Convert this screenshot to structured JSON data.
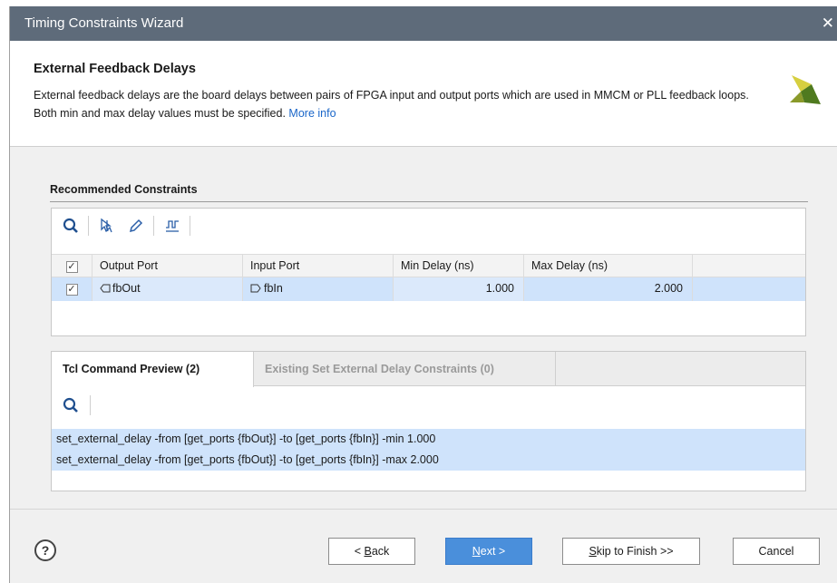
{
  "window": {
    "title": "Timing Constraints Wizard",
    "close_glyph": "✕"
  },
  "header": {
    "title": "External Feedback Delays",
    "description": "External feedback delays are the board delays between pairs of FPGA input and output ports which are used in MMCM or PLL feedback loops. Both min and max delay values must be specified.",
    "more_info": "More info"
  },
  "recommended": {
    "label": "Recommended Constraints",
    "toolbar": [
      "search-icon",
      "select-pointer-icon",
      "edit-pencil-icon",
      "waveform-icon"
    ],
    "columns": [
      "Output Port",
      "Input Port",
      "Min Delay (ns)",
      "Max Delay (ns)"
    ],
    "header_checked": true,
    "rows": [
      {
        "checked": true,
        "output_port": "fbOut",
        "input_port": "fbIn",
        "min_delay": "1.000",
        "max_delay": "2.000"
      }
    ]
  },
  "tcl": {
    "tabs": [
      {
        "label": "Tcl Command Preview (2)",
        "active": true
      },
      {
        "label": "Existing Set External Delay Constraints (0)",
        "active": false
      }
    ],
    "lines": [
      "set_external_delay -from [get_ports {fbOut}] -to [get_ports {fbIn}] -min 1.000",
      "set_external_delay -from [get_ports {fbOut}] -to [get_ports {fbIn}] -max 2.000"
    ]
  },
  "footer": {
    "help": "?",
    "back": {
      "prefix": "< ",
      "mnemonic": "B",
      "rest": "ack"
    },
    "next": {
      "mnemonic": "N",
      "rest": "ext >"
    },
    "skip": {
      "mnemonic": "S",
      "rest": "kip to Finish >>"
    },
    "cancel": "Cancel"
  },
  "colors": {
    "titlebar": "#5e6b7a",
    "selection": "#cfe3fb",
    "primary_button": "#4a8fdb",
    "link": "#1a66c9",
    "logo_yellow": "#d6cf3f",
    "logo_green": "#4f7a1f"
  }
}
